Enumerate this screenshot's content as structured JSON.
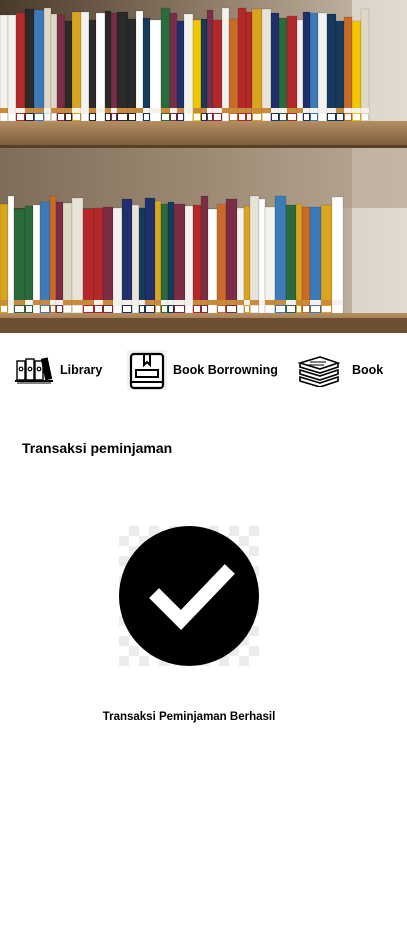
{
  "hero": {
    "alt": "Bookshelf photo"
  },
  "nav": {
    "items": [
      {
        "label": "Library",
        "icon": "library-books-icon"
      },
      {
        "label": "Book Borrowning",
        "icon": "book-borrowing-icon"
      },
      {
        "label": "Book",
        "icon": "book-stack-icon"
      }
    ]
  },
  "content": {
    "title": "Transaksi peminjaman",
    "success_icon": "check-circle-icon",
    "success_message": "Transaksi Peminjaman Berhasil"
  },
  "colors": {
    "background": "#ffffff",
    "text": "#000000",
    "icon": "#000000"
  }
}
